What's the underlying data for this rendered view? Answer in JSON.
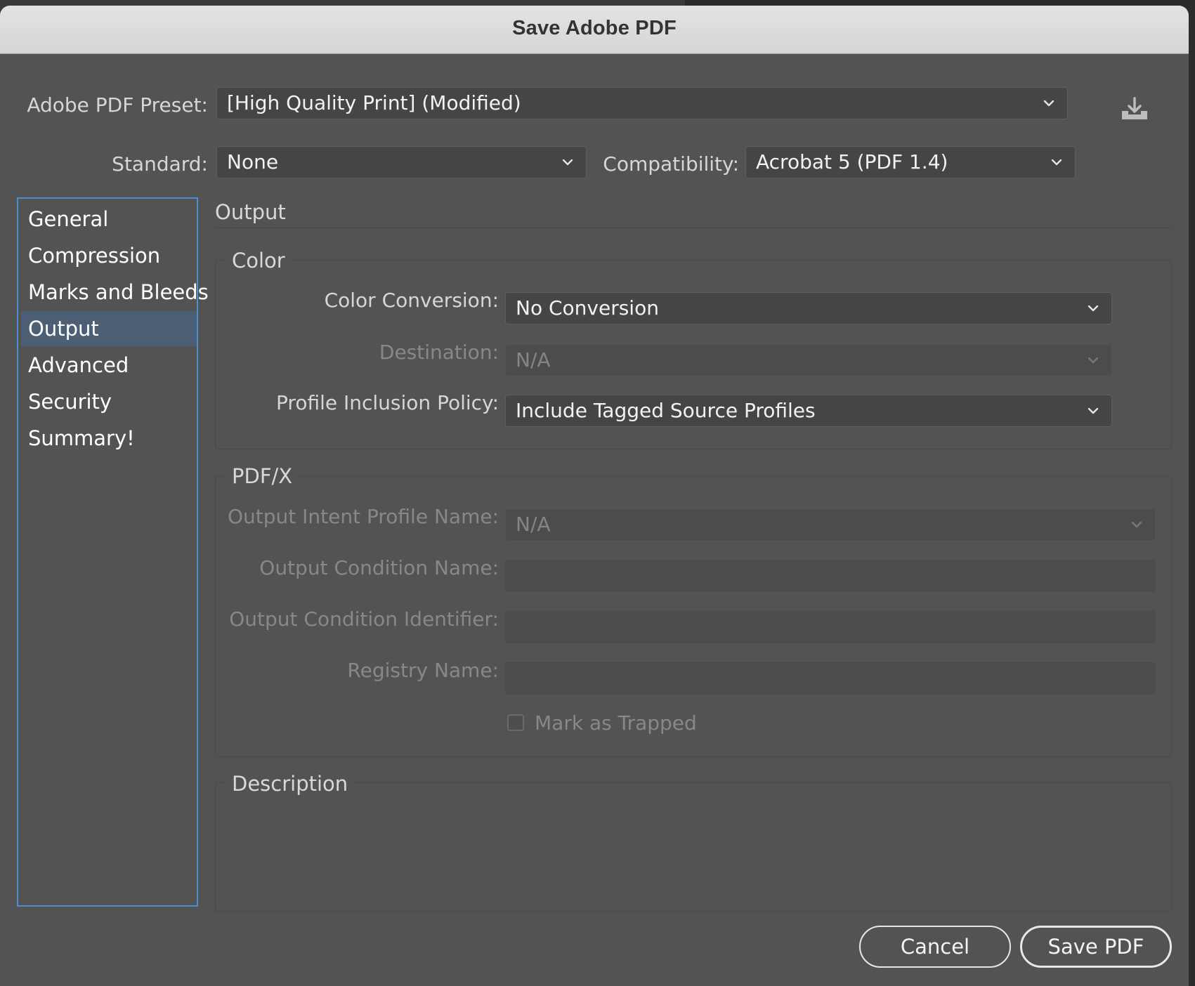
{
  "window": {
    "title": "Save Adobe PDF"
  },
  "preset": {
    "label": "Adobe PDF Preset:",
    "value": "[High Quality Print] (Modified)"
  },
  "standard": {
    "label": "Standard:",
    "value": "None"
  },
  "compatibility": {
    "label": "Compatibility:",
    "value": "Acrobat 5 (PDF 1.4)"
  },
  "sidebar": {
    "items": [
      {
        "label": "General"
      },
      {
        "label": "Compression"
      },
      {
        "label": "Marks and Bleeds"
      },
      {
        "label": "Output",
        "active": true
      },
      {
        "label": "Advanced"
      },
      {
        "label": "Security"
      },
      {
        "label": "Summary!"
      }
    ]
  },
  "panel": {
    "title": "Output",
    "color": {
      "title": "Color",
      "color_conversion": {
        "label": "Color Conversion:",
        "value": "No Conversion"
      },
      "destination": {
        "label": "Destination:",
        "value": "N/A",
        "disabled": true
      },
      "profile_inclusion": {
        "label": "Profile Inclusion Policy:",
        "value": "Include Tagged Source Profiles"
      }
    },
    "pdfx": {
      "title": "PDF/X",
      "output_intent": {
        "label": "Output Intent Profile Name:",
        "value": "N/A",
        "disabled": true
      },
      "output_condition_name": {
        "label": "Output Condition Name:",
        "value": ""
      },
      "output_condition_identifier": {
        "label": "Output Condition Identifier:",
        "value": ""
      },
      "registry_name": {
        "label": "Registry Name:",
        "value": ""
      },
      "mark_as_trapped": {
        "label": "Mark as Trapped",
        "checked": false
      }
    },
    "description": {
      "title": "Description",
      "text": ""
    }
  },
  "buttons": {
    "cancel": "Cancel",
    "save": "Save PDF"
  },
  "icons": {
    "save_preset": "download-tray-icon",
    "chevron": "chevron-down-icon"
  },
  "colors": {
    "dialog_bg": "#535353",
    "accent": "#4b8fd0",
    "selected_bg": "#4c5f75"
  }
}
